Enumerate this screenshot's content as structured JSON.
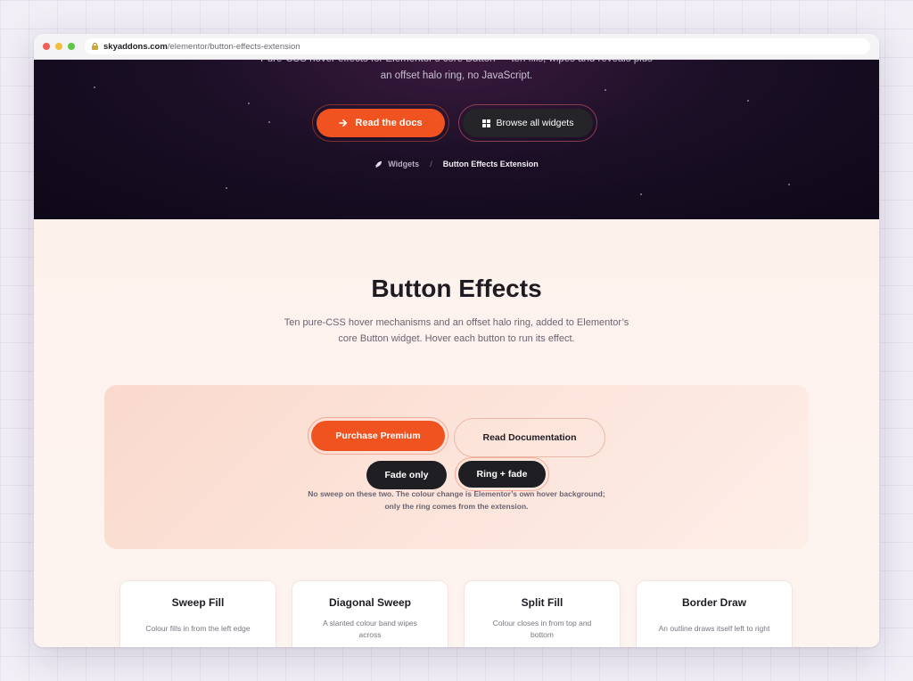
{
  "browser": {
    "url_host": "skyaddons.com",
    "url_path": "/elementor/button-effects-extension",
    "traffic_lights": [
      "#ee5f57",
      "#f4bd3b",
      "#5ec842"
    ]
  },
  "hero": {
    "subtitle_line1": "Pure-CSS hover effects for Elementor’s core Button — ten fills, wipes and reveals plus",
    "subtitle_line2": "an offset halo ring, no JavaScript.",
    "primary_button": "Read the docs",
    "secondary_button": "Browse all widgets",
    "breadcrumb": {
      "parent": "Widgets",
      "separator": "/",
      "current": "Button Effects Extension"
    }
  },
  "main": {
    "title": "Button Effects",
    "lead": "Ten pure-CSS hover mechanisms and an offset halo ring, added to Elementor’s core Button widget. Hover each button to run its effect.",
    "demo": {
      "purchase_button": "Purchase Premium",
      "documentation_button": "Read Documentation",
      "fade_button": "Fade only",
      "ring_fade_button": "Ring + fade",
      "note": "No sweep on these two. The colour change is Elementor’s own hover background; only the ring comes from the extension."
    },
    "cards": [
      {
        "title": "Sweep Fill",
        "desc": "Colour fills in from the left edge"
      },
      {
        "title": "Diagonal Sweep",
        "desc": "A slanted colour band wipes across"
      },
      {
        "title": "Split Fill",
        "desc": "Colour closes in from top and bottom"
      },
      {
        "title": "Border Draw",
        "desc": "An outline draws itself left to right"
      }
    ]
  },
  "colors": {
    "accent": "#f0531f",
    "dark": "#1f1e22"
  }
}
